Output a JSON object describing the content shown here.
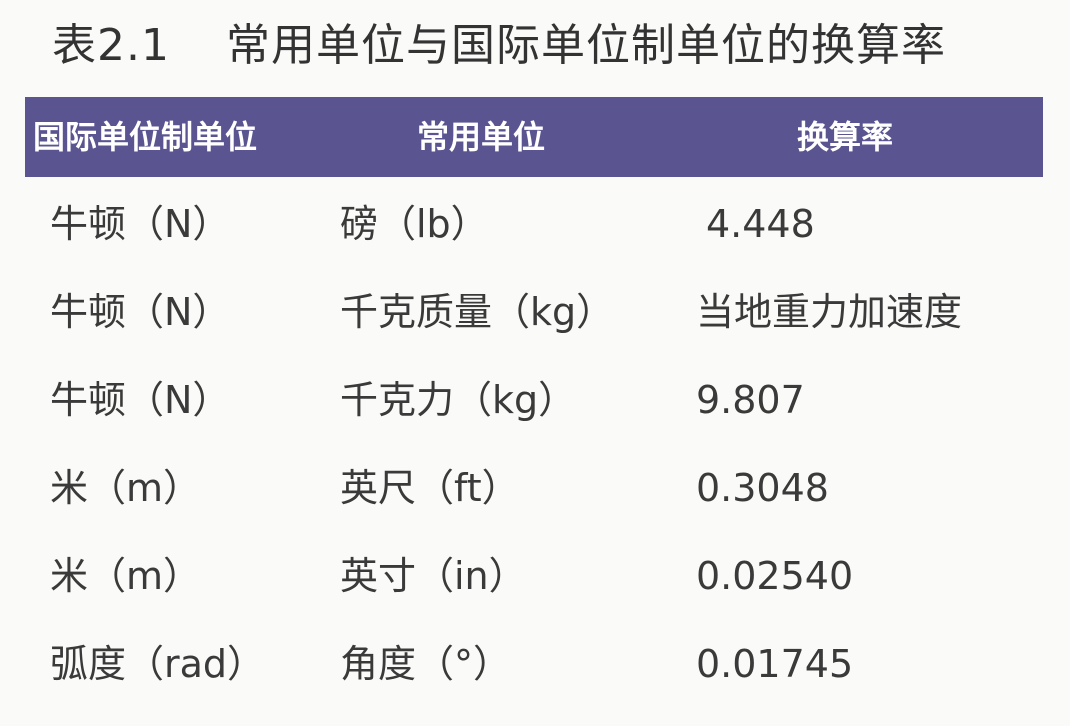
{
  "title": {
    "number": "表2.1",
    "text": "常用单位与国际单位制单位的换算率"
  },
  "table": {
    "headers": [
      "国际单位制单位",
      "常用单位",
      "换算率"
    ],
    "rows": [
      [
        "牛顿（N）",
        "磅（lb）",
        "4.448"
      ],
      [
        "牛顿（N）",
        "千克质量（kg）",
        "当地重力加速度"
      ],
      [
        "牛顿（N）",
        "千克力（kg）",
        "9.807"
      ],
      [
        "米（m）",
        "英尺（ft）",
        "0.3048"
      ],
      [
        "米（m）",
        "英寸（in）",
        "0.02540"
      ],
      [
        "弧度（rad）",
        "角度（°）",
        "0.01745"
      ]
    ]
  },
  "colors": {
    "header_bg": "#5a5490",
    "header_text": "#ffffff",
    "body_text": "#3a3a3a"
  }
}
